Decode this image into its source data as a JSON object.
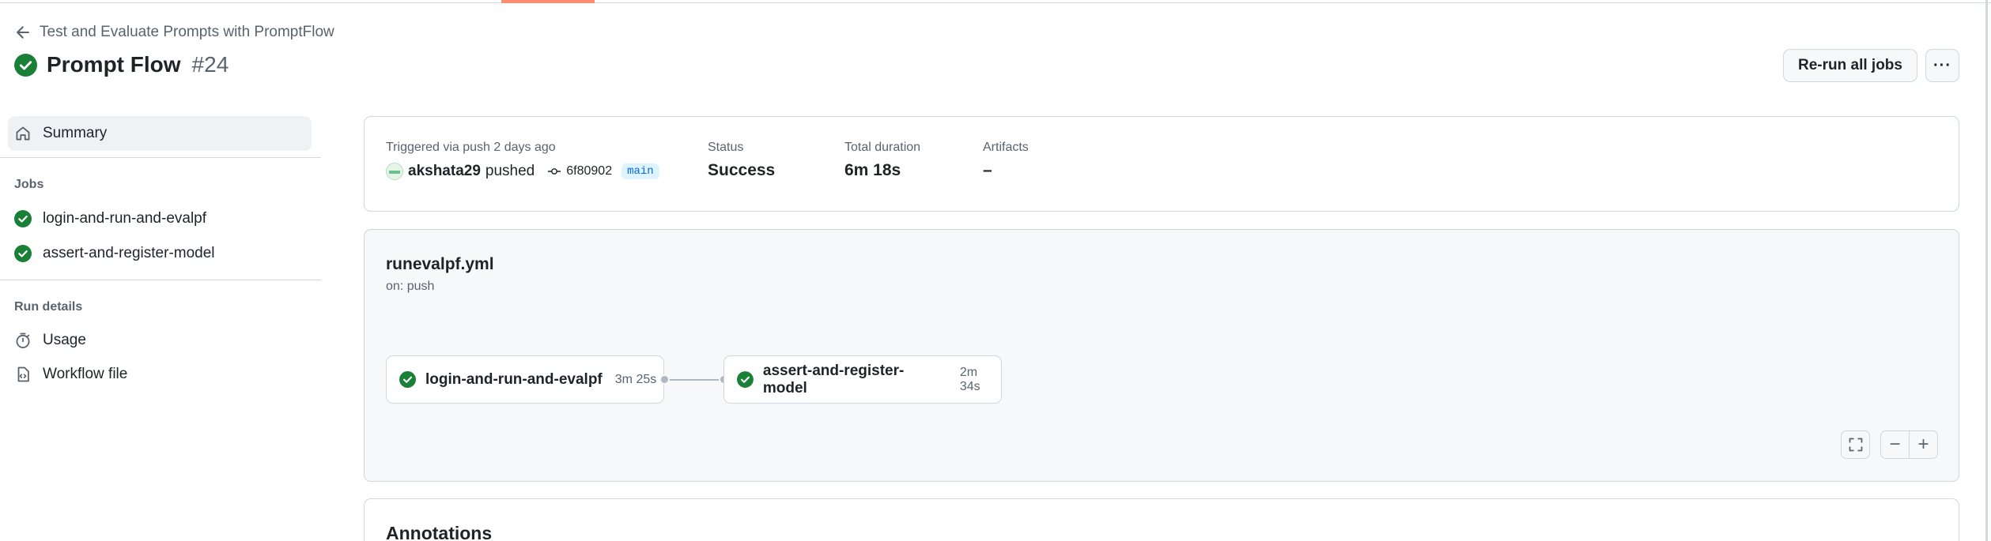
{
  "header": {
    "back_label": "Test and Evaluate Prompts with PromptFlow",
    "title": "Prompt Flow",
    "run_number": "#24",
    "rerun_label": "Re-run all jobs",
    "more_label": "···"
  },
  "sidebar": {
    "summary_label": "Summary",
    "jobs_heading": "Jobs",
    "jobs": [
      {
        "label": "login-and-run-and-evalpf"
      },
      {
        "label": "assert-and-register-model"
      }
    ],
    "run_details_heading": "Run details",
    "usage_label": "Usage",
    "workflow_file_label": "Workflow file"
  },
  "summary": {
    "trigger_label": "Triggered via push 2 days ago",
    "user": "akshata29",
    "action": "pushed",
    "commit": "6f80902",
    "branch": "main",
    "status_label": "Status",
    "status_value": "Success",
    "duration_label": "Total duration",
    "duration_value": "6m 18s",
    "artifacts_label": "Artifacts",
    "artifacts_value": "–"
  },
  "workflow": {
    "file": "runevalpf.yml",
    "trigger": "on: push",
    "jobs": [
      {
        "name": "login-and-run-and-evalpf",
        "duration": "3m 25s"
      },
      {
        "name": "assert-and-register-model",
        "duration": "2m 34s"
      }
    ],
    "controls": {
      "minus": "−",
      "plus": "+"
    }
  },
  "annotations": {
    "title": "Annotations"
  },
  "colors": {
    "success": "#1a7f37",
    "accent": "#fd8c73",
    "link": "#0969da",
    "muted": "#59636e"
  }
}
